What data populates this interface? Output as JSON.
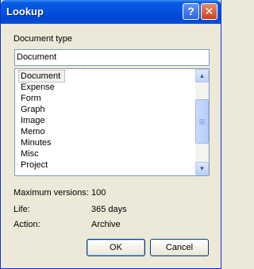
{
  "window": {
    "title": "Lookup"
  },
  "titlebar": {
    "help_glyph": "?",
    "close_glyph": "✕"
  },
  "document_type": {
    "label": "Document type",
    "value": "Document",
    "options": [
      "Document",
      "Expense",
      "Form",
      "Graph",
      "Image",
      "Memo",
      "Minutes",
      "Misc",
      "Project"
    ],
    "selected": "Document"
  },
  "scrollbar": {
    "up_glyph": "▲",
    "down_glyph": "▼"
  },
  "info": {
    "max_versions_label": "Maximum versions:",
    "max_versions_value": "100",
    "life_label": "Life:",
    "life_value": "365 days",
    "action_label": "Action:",
    "action_value": "Archive"
  },
  "buttons": {
    "ok": "OK",
    "cancel": "Cancel"
  }
}
